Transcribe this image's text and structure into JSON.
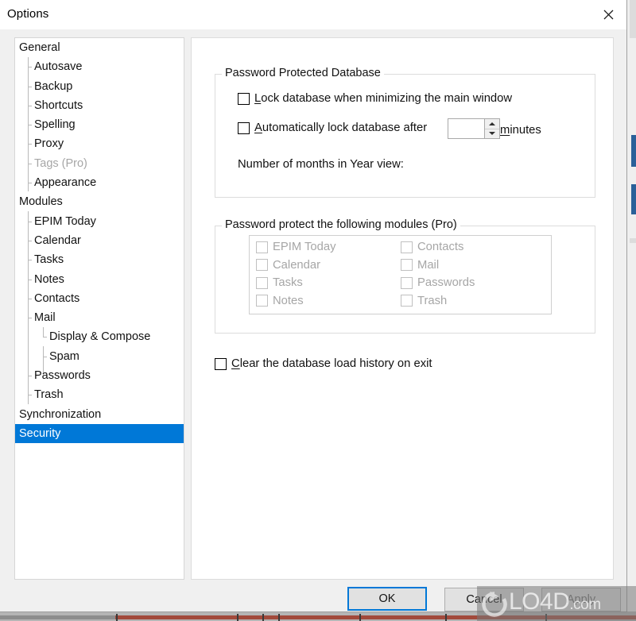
{
  "window": {
    "title": "Options",
    "close_icon": "close-icon"
  },
  "sidebar": {
    "items": [
      {
        "label": "General",
        "level": 0,
        "disabled": false,
        "selected": false
      },
      {
        "label": "Autosave",
        "level": 1,
        "disabled": false,
        "selected": false
      },
      {
        "label": "Backup",
        "level": 1,
        "disabled": false,
        "selected": false
      },
      {
        "label": "Shortcuts",
        "level": 1,
        "disabled": false,
        "selected": false
      },
      {
        "label": "Spelling",
        "level": 1,
        "disabled": false,
        "selected": false
      },
      {
        "label": "Proxy",
        "level": 1,
        "disabled": false,
        "selected": false
      },
      {
        "label": "Tags (Pro)",
        "level": 1,
        "disabled": true,
        "selected": false
      },
      {
        "label": "Appearance",
        "level": 1,
        "disabled": false,
        "selected": false
      },
      {
        "label": "Modules",
        "level": 0,
        "disabled": false,
        "selected": false
      },
      {
        "label": "EPIM Today",
        "level": 1,
        "disabled": false,
        "selected": false
      },
      {
        "label": "Calendar",
        "level": 1,
        "disabled": false,
        "selected": false
      },
      {
        "label": "Tasks",
        "level": 1,
        "disabled": false,
        "selected": false
      },
      {
        "label": "Notes",
        "level": 1,
        "disabled": false,
        "selected": false
      },
      {
        "label": "Contacts",
        "level": 1,
        "disabled": false,
        "selected": false
      },
      {
        "label": "Mail",
        "level": 1,
        "disabled": false,
        "selected": false
      },
      {
        "label": "Display & Compose",
        "level": 2,
        "disabled": false,
        "selected": false
      },
      {
        "label": "Spam",
        "level": 2,
        "disabled": false,
        "selected": false
      },
      {
        "label": "Passwords",
        "level": 1,
        "disabled": false,
        "selected": false
      },
      {
        "label": "Trash",
        "level": 1,
        "disabled": false,
        "selected": false
      },
      {
        "label": "Synchronization",
        "level": 0,
        "disabled": false,
        "selected": false
      },
      {
        "label": "Security",
        "level": 0,
        "disabled": false,
        "selected": true
      }
    ],
    "selection_color": "#0078d7"
  },
  "main": {
    "group_password_db": {
      "title": "Password Protected Database",
      "lock_on_minimize": {
        "label_pre": "",
        "accel": "L",
        "label_post": "ock database when minimizing the main window",
        "checked": false
      },
      "auto_lock": {
        "accel": "A",
        "label_post": "utomatically lock database after",
        "checked": false
      },
      "spin_value": "",
      "minutes": {
        "accel": "m",
        "label_post": "inutes"
      },
      "months_in_year_view": "Number of months in Year view:"
    },
    "group_modules": {
      "title": "Password protect the following modules (Pro)",
      "left_column": [
        {
          "label": "EPIM Today",
          "checked": false,
          "disabled": true
        },
        {
          "label": "Calendar",
          "checked": false,
          "disabled": true
        },
        {
          "label": "Tasks",
          "checked": false,
          "disabled": true
        },
        {
          "label": "Notes",
          "checked": false,
          "disabled": true
        }
      ],
      "right_column": [
        {
          "label": "Contacts",
          "checked": false,
          "disabled": true
        },
        {
          "label": "Mail",
          "checked": false,
          "disabled": true
        },
        {
          "label": "Passwords",
          "checked": false,
          "disabled": true
        },
        {
          "label": "Trash",
          "checked": false,
          "disabled": true
        }
      ]
    },
    "clear_history": {
      "accel": "C",
      "label_post": "lear the database load history on exit",
      "checked": false
    }
  },
  "footer": {
    "ok": "OK",
    "cancel": "Cancel",
    "apply": "Apply"
  },
  "watermark": {
    "brand": "LO4D",
    "domain": ".com"
  }
}
